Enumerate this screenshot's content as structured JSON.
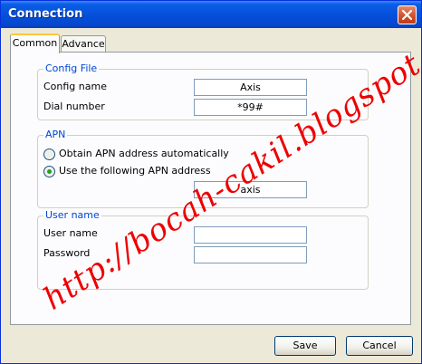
{
  "window": {
    "title": "Connection"
  },
  "tabs": [
    {
      "label": "Common",
      "active": true
    },
    {
      "label": "Advance",
      "active": false
    }
  ],
  "config_file": {
    "legend": "Config File",
    "config_name_label": "Config name",
    "config_name_value": "Axis",
    "dial_number_label": "Dial number",
    "dial_number_value": "*99#"
  },
  "apn": {
    "legend": "APN",
    "option_auto": "Obtain APN address automatically",
    "option_manual": "Use the following APN address",
    "selected": "manual",
    "address_value": "axis"
  },
  "user_name": {
    "legend": "User name",
    "user_name_label": "User name",
    "user_name_value": "",
    "password_label": "Password",
    "password_value": ""
  },
  "buttons": {
    "save": "Save",
    "cancel": "Cancel"
  },
  "watermark": "http://bocah-cakil.blogspot.com",
  "colors": {
    "title_bar": "#0550dc",
    "group_legend": "#0046d5",
    "watermark": "#ee0000",
    "tab_highlight": "#ffc83c"
  }
}
